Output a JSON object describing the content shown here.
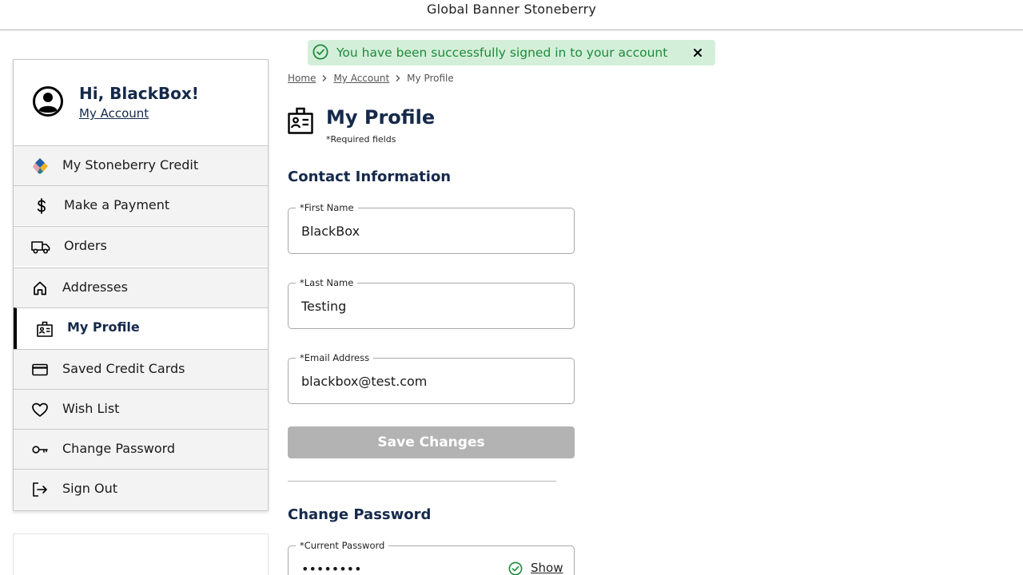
{
  "banner": {
    "title": "Global Banner Stoneberry"
  },
  "toast": {
    "message": "You have been successfully signed in to your account",
    "close_icon": "close-icon",
    "status_icon": "check-circle-icon",
    "color": "#1f8a3b",
    "background": "#d3efd9"
  },
  "sidebar": {
    "greeting": "Hi, BlackBox!",
    "account_link": "My Account",
    "items": [
      {
        "label": "My Stoneberry Credit",
        "icon": "stoneberry-logo-icon"
      },
      {
        "label": "Make a Payment",
        "icon": "dollar-icon"
      },
      {
        "label": "Orders",
        "icon": "truck-icon"
      },
      {
        "label": "Addresses",
        "icon": "home-icon"
      },
      {
        "label": "My Profile",
        "icon": "id-card-icon",
        "active": true
      },
      {
        "label": "Saved Credit Cards",
        "icon": "credit-card-icon"
      },
      {
        "label": "Wish List",
        "icon": "heart-icon"
      },
      {
        "label": "Change Password",
        "icon": "key-icon"
      },
      {
        "label": "Sign Out",
        "icon": "sign-out-icon"
      }
    ]
  },
  "breadcrumb": {
    "items": [
      "Home",
      "My Account",
      "My Profile"
    ]
  },
  "page": {
    "title": "My Profile",
    "required_note": "*Required fields",
    "contact_heading": "Contact Information",
    "password_heading": "Change Password"
  },
  "form": {
    "first_name": {
      "label": "*First Name",
      "value": "BlackBox"
    },
    "last_name": {
      "label": "*Last Name",
      "value": "Testing"
    },
    "email": {
      "label": "*Email Address",
      "value": "blackbox@test.com"
    },
    "save_label": "Save Changes",
    "current_password": {
      "label": "*Current Password",
      "value": "••••••••",
      "show_label": "Show"
    }
  },
  "colors": {
    "navy": "#15294a",
    "success": "#1f8a3b",
    "disabled": "#b3b3b3"
  }
}
